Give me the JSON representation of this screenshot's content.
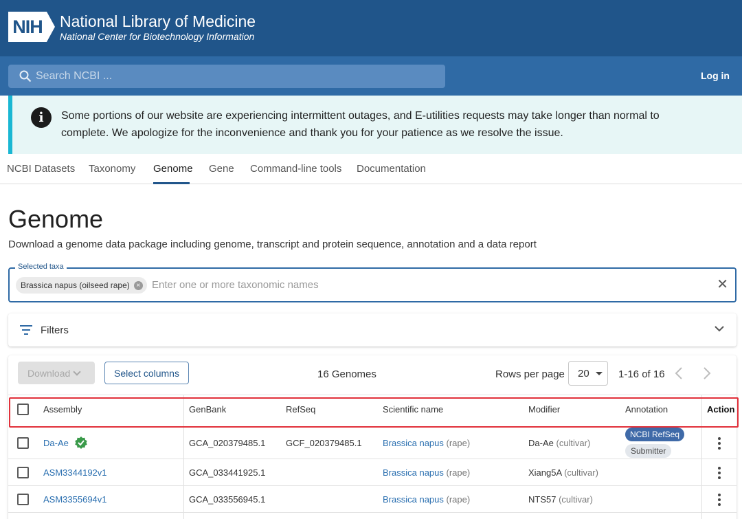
{
  "header": {
    "logo_text": "NIH",
    "title": "National Library of Medicine",
    "subtitle": "National Center for Biotechnology Information"
  },
  "search": {
    "placeholder": "Search NCBI ..."
  },
  "login_label": "Log in",
  "alert": {
    "icon": "info-icon",
    "icon_glyph": "i",
    "line1": "Some portions of our website are experiencing intermittent outages, and E-utilities requests may take longer than normal to",
    "line2": "complete. We apologize for the inconvenience and thank you for your patience as we resolve the issue."
  },
  "tabs": [
    {
      "label": "NCBI Datasets"
    },
    {
      "label": "Taxonomy"
    },
    {
      "label": "Genome",
      "active": true
    },
    {
      "label": "Gene"
    },
    {
      "label": "Command-line tools"
    },
    {
      "label": "Documentation"
    }
  ],
  "page": {
    "title": "Genome",
    "description": "Download a genome data package including genome, transcript and protein sequence, annotation and a data report"
  },
  "taxa": {
    "label": "Selected taxa",
    "chip": "Brassica napus (oilseed rape)",
    "placeholder": "Enter one or more taxonomic names",
    "clear_glyph": "✕"
  },
  "filters": {
    "label": "Filters"
  },
  "toolbar": {
    "download_label": "Download",
    "select_columns_label": "Select columns",
    "genome_count": "16 Genomes",
    "rows_per_page_label": "Rows per page",
    "rows_per_page_value": "20",
    "range": "1-16 of 16"
  },
  "table": {
    "columns": [
      "Assembly",
      "GenBank",
      "RefSeq",
      "Scientific name",
      "Modifier",
      "Annotation",
      "Action"
    ],
    "rows": [
      {
        "assembly": "Da-Ae",
        "verified": true,
        "genbank": "GCA_020379485.1",
        "refseq": "GCF_020379485.1",
        "sci_name": "Brassica napus",
        "sci_common": "(rape)",
        "modifier": "Da-Ae",
        "modifier_type": "(cultivar)",
        "annotation": [
          "NCBI RefSeq",
          "Submitter"
        ]
      },
      {
        "assembly": "ASM3344192v1",
        "verified": false,
        "genbank": "GCA_033441925.1",
        "refseq": "",
        "sci_name": "Brassica napus",
        "sci_common": "(rape)",
        "modifier": "Xiang5A",
        "modifier_type": "(cultivar)",
        "annotation": []
      },
      {
        "assembly": "ASM3355694v1",
        "verified": false,
        "genbank": "GCA_033556945.1",
        "refseq": "",
        "sci_name": "Brassica napus",
        "sci_common": "(rape)",
        "modifier": "NTS57",
        "modifier_type": "(cultivar)",
        "annotation": []
      }
    ]
  },
  "colors": {
    "header_bg": "#20558a",
    "search_band": "#2f6aa5",
    "alert_bg": "#e7f6f6",
    "alert_accent": "#1ab7d3",
    "link": "#2a6fb0",
    "highlight": "#e1303a"
  }
}
